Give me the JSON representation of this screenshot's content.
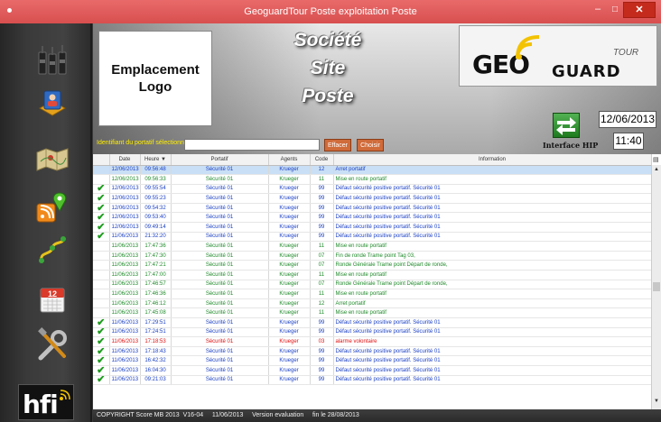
{
  "window": {
    "title": "GeoguardTour  Poste exploitation  Poste",
    "minimize": "–",
    "maximize": "□",
    "close": "✕"
  },
  "sidebar": {
    "items": [
      {
        "icon": "walkie-talkie-icon"
      },
      {
        "icon": "user-map-icon"
      },
      {
        "icon": "map-icon"
      },
      {
        "icon": "rss-location-icon"
      },
      {
        "icon": "route-icon"
      },
      {
        "icon": "calendar-icon"
      },
      {
        "icon": "tools-icon"
      }
    ],
    "hfi_logo": "hfi"
  },
  "header": {
    "logo_placeholder": "Emplacement\nLogo",
    "company": "Société",
    "site": "Site",
    "poste": "Poste",
    "brand_geo": "GEO",
    "brand_guard": "GUARD",
    "brand_tour": "TOUR",
    "ident_label": "Identifiant du portatif sélectionné",
    "ident_value": "",
    "effacer_label": "Effacer",
    "choisir_label": "Choisir",
    "hip_label": "Interface HIP",
    "date": "12/06/2013",
    "time": "11:40",
    "accent_color": "#ffef00",
    "button_color": "#d06b3a"
  },
  "table": {
    "columns": [
      "",
      "Date",
      "Heure",
      "Portatif",
      "Agents",
      "Code",
      "Information"
    ],
    "sort_indicator": "▼",
    "rows": [
      {
        "check": "",
        "date": "12/06/2013",
        "time": "09:56:48",
        "portatif": "Sécurité 01",
        "agent": "Krueger",
        "code": "12",
        "info": "Arret portatif",
        "color": "blue",
        "selected": true
      },
      {
        "check": "",
        "date": "12/06/2013",
        "time": "09:56:33",
        "portatif": "Sécurité 01",
        "agent": "Krueger",
        "code": "11",
        "info": "Mise en route portatif",
        "color": "green"
      },
      {
        "check": "✔",
        "date": "12/06/2013",
        "time": "09:55:54",
        "portatif": "Sécurité 01",
        "agent": "Krueger",
        "code": "99",
        "info": "Défaut sécurité positive  portatif.  Sécurité 01",
        "color": "blue"
      },
      {
        "check": "✔",
        "date": "12/06/2013",
        "time": "09:55:23",
        "portatif": "Sécurité 01",
        "agent": "Krueger",
        "code": "99",
        "info": "Défaut sécurité positive  portatif.  Sécurité 01",
        "color": "blue"
      },
      {
        "check": "✔",
        "date": "12/06/2013",
        "time": "09:54:32",
        "portatif": "Sécurité 01",
        "agent": "Krueger",
        "code": "99",
        "info": "Défaut sécurité positive  portatif.  Sécurité 01",
        "color": "blue"
      },
      {
        "check": "✔",
        "date": "12/06/2013",
        "time": "09:53:40",
        "portatif": "Sécurité 01",
        "agent": "Krueger",
        "code": "99",
        "info": "Défaut sécurité positive  portatif.  Sécurité 01",
        "color": "blue"
      },
      {
        "check": "✔",
        "date": "12/06/2013",
        "time": "09:49:14",
        "portatif": "Sécurité 01",
        "agent": "Krueger",
        "code": "99",
        "info": "Défaut sécurité positive  portatif.  Sécurité 01",
        "color": "blue"
      },
      {
        "check": "✔",
        "date": "11/06/2013",
        "time": "21:32:20",
        "portatif": "Sécurité 01",
        "agent": "Krueger",
        "code": "99",
        "info": "Défaut sécurité positive  portatif.  Sécurité 01",
        "color": "blue"
      },
      {
        "check": "",
        "date": "11/06/2013",
        "time": "17:47:36",
        "portatif": "Sécurité 01",
        "agent": "Krueger",
        "code": "11",
        "info": "Mise en route portatif",
        "color": "green"
      },
      {
        "check": "",
        "date": "11/06/2013",
        "time": "17:47:30",
        "portatif": "Sécurité 01",
        "agent": "Krueger",
        "code": "07",
        "info": "Fin de ronde   Trame point Tag 03,",
        "color": "green"
      },
      {
        "check": "",
        "date": "11/06/2013",
        "time": "17:47:21",
        "portatif": "Sécurité 01",
        "agent": "Krueger",
        "code": "07",
        "info": "Ronde Générale   Trame point Départ de ronde,",
        "color": "green"
      },
      {
        "check": "",
        "date": "11/06/2013",
        "time": "17:47:00",
        "portatif": "Sécurité 01",
        "agent": "Krueger",
        "code": "11",
        "info": "Mise en route portatif",
        "color": "green"
      },
      {
        "check": "",
        "date": "11/06/2013",
        "time": "17:46:57",
        "portatif": "Sécurité 01",
        "agent": "Krueger",
        "code": "07",
        "info": "Ronde Générale   Trame point Départ de ronde,",
        "color": "green"
      },
      {
        "check": "",
        "date": "11/06/2013",
        "time": "17:46:36",
        "portatif": "Sécurité 01",
        "agent": "Krueger",
        "code": "11",
        "info": "Mise en route portatif",
        "color": "green"
      },
      {
        "check": "",
        "date": "11/06/2013",
        "time": "17:46:12",
        "portatif": "Sécurité 01",
        "agent": "Krueger",
        "code": "12",
        "info": "Arret portatif",
        "color": "green"
      },
      {
        "check": "",
        "date": "11/06/2013",
        "time": "17:45:08",
        "portatif": "Sécurité 01",
        "agent": "Krueger",
        "code": "11",
        "info": "Mise en route portatif",
        "color": "green"
      },
      {
        "check": "✔",
        "date": "11/06/2013",
        "time": "17:29:51",
        "portatif": "Sécurité 01",
        "agent": "Krueger",
        "code": "99",
        "info": "Défaut sécurité positive  portatif.  Sécurité 01",
        "color": "blue"
      },
      {
        "check": "✔",
        "date": "11/06/2013",
        "time": "17:24:51",
        "portatif": "Sécurité 01",
        "agent": "Krueger",
        "code": "99",
        "info": "Défaut sécurité positive  portatif.  Sécurité 01",
        "color": "blue"
      },
      {
        "check": "✔",
        "date": "11/06/2013",
        "time": "17:18:53",
        "portatif": "Sécurité 01",
        "agent": "Krueger",
        "code": "03",
        "info": "alarme volontaire",
        "color": "red"
      },
      {
        "check": "✔",
        "date": "11/06/2013",
        "time": "17:18:43",
        "portatif": "Sécurité 01",
        "agent": "Krueger",
        "code": "99",
        "info": "Défaut sécurité positive  portatif.  Sécurité 01",
        "color": "blue"
      },
      {
        "check": "✔",
        "date": "11/06/2013",
        "time": "16:42:32",
        "portatif": "Sécurité 01",
        "agent": "Krueger",
        "code": "99",
        "info": "Défaut sécurité positive  portatif.  Sécurité 01",
        "color": "blue"
      },
      {
        "check": "✔",
        "date": "11/06/2013",
        "time": "16:04:30",
        "portatif": "Sécurité 01",
        "agent": "Krueger",
        "code": "99",
        "info": "Défaut sécurité positive  portatif.  Sécurité 01",
        "color": "blue"
      },
      {
        "check": "✔",
        "date": "11/06/2013",
        "time": "09:21:03",
        "portatif": "Sécurité 01",
        "agent": "Krueger",
        "code": "99",
        "info": "Défaut sécurité positive  portatif.  Sécurité 01",
        "color": "blue"
      }
    ]
  },
  "scrollbar": {
    "up": "▲",
    "down": "▼"
  },
  "footer": {
    "text": "COPYRIGHT Score MB 2013  V16-04     11/06/2013     Version evaluation     fin le 28/08/2013"
  }
}
